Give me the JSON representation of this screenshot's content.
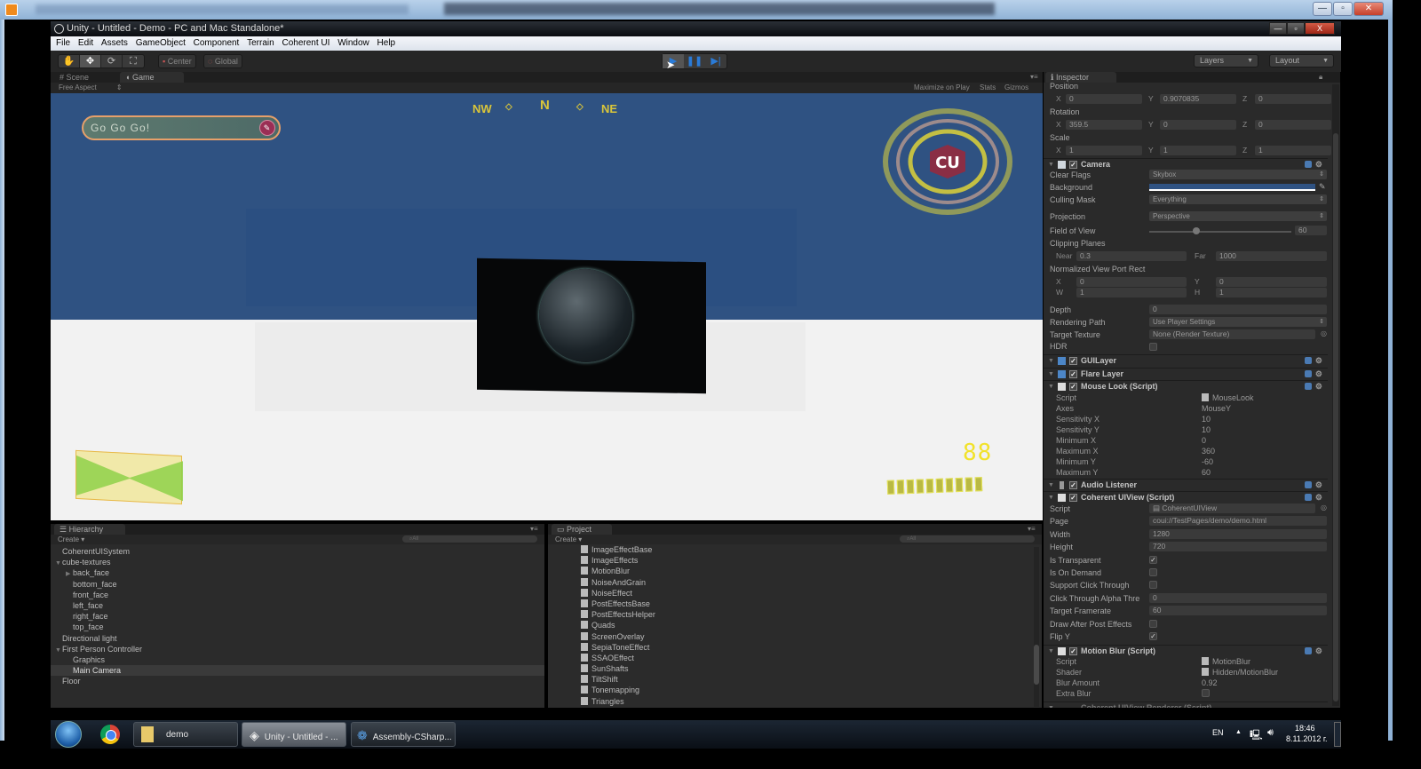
{
  "window": {
    "title": "Unity - Untitled - Demo - PC and Mac Standalone*",
    "controls": {
      "minimize": "—",
      "maximize": "▫",
      "close": "X"
    }
  },
  "menu": [
    "File",
    "Edit",
    "Assets",
    "GameObject",
    "Component",
    "Terrain",
    "Coherent UI",
    "Window",
    "Help"
  ],
  "toolbar": {
    "tools": [
      "hand-icon",
      "move-icon",
      "rotate-icon",
      "scale-icon"
    ],
    "pivot_center": "Center",
    "pivot_global": "Global",
    "play": "▶",
    "pause": "❚❚",
    "step": "▶|",
    "layers": "Layers",
    "layout": "Layout"
  },
  "tabs": {
    "scene": "Scene",
    "game": "Game",
    "inspector": "Inspector",
    "hierarchy": "Hierarchy",
    "project": "Project"
  },
  "game_view": {
    "aspect": "Free Aspect",
    "maximize_on_play": "Maximize on Play",
    "stats": "Stats",
    "gizmos": "Gizmos",
    "hud": {
      "chat_text": "Go Go Go!",
      "compass": {
        "nw": "NW",
        "n": "N",
        "ne": "NE"
      },
      "logo": "CU",
      "health": "88",
      "health_segments": 10,
      "health_fraction": 1.0
    }
  },
  "hierarchy": {
    "create": "Create ▾",
    "search_placeholder": "All",
    "items": [
      {
        "label": "CoherentUISystem",
        "depth": 0,
        "arrow": ""
      },
      {
        "label": "cube-textures",
        "depth": 0,
        "arrow": "▼"
      },
      {
        "label": "back_face",
        "depth": 1,
        "arrow": "▶"
      },
      {
        "label": "bottom_face",
        "depth": 1,
        "arrow": ""
      },
      {
        "label": "front_face",
        "depth": 1,
        "arrow": ""
      },
      {
        "label": "left_face",
        "depth": 1,
        "arrow": ""
      },
      {
        "label": "right_face",
        "depth": 1,
        "arrow": ""
      },
      {
        "label": "top_face",
        "depth": 1,
        "arrow": ""
      },
      {
        "label": "Directional light",
        "depth": 0,
        "arrow": ""
      },
      {
        "label": "First Person Controller",
        "depth": 0,
        "arrow": "▼"
      },
      {
        "label": "Graphics",
        "depth": 1,
        "arrow": ""
      },
      {
        "label": "Main Camera",
        "depth": 1,
        "arrow": "",
        "selected": true
      },
      {
        "label": "Floor",
        "depth": 0,
        "arrow": ""
      }
    ]
  },
  "project": {
    "create": "Create ▾",
    "search_placeholder": "All",
    "items": [
      "ImageEffectBase",
      "ImageEffects",
      "MotionBlur",
      "NoiseAndGrain",
      "NoiseEffect",
      "PostEffectsBase",
      "PostEffectsHelper",
      "Quads",
      "ScreenOverlay",
      "SepiaToneEffect",
      "SSAOEffect",
      "SunShafts",
      "TiltShift",
      "Tonemapping",
      "Triangles"
    ]
  },
  "inspector": {
    "transform": {
      "position_label": "Position",
      "position": {
        "x": "0",
        "y": "0.9070835",
        "z": "0"
      },
      "rotation_label": "Rotation",
      "rotation": {
        "x": "359.5",
        "y": "0",
        "z": "0"
      },
      "scale_label": "Scale",
      "scale": {
        "x": "1",
        "y": "1",
        "z": "1"
      }
    },
    "camera": {
      "title": "Camera",
      "clear_flags_label": "Clear Flags",
      "clear_flags": "Skybox",
      "background_label": "Background",
      "background_color": "#2f5282",
      "culling_mask_label": "Culling Mask",
      "culling_mask": "Everything",
      "projection_label": "Projection",
      "projection": "Perspective",
      "fov_label": "Field of View",
      "fov": "60",
      "fov_slider_fraction": 0.33,
      "clipping_label": "Clipping Planes",
      "near_label": "Near",
      "near": "0.3",
      "far_label": "Far",
      "far": "1000",
      "viewport_label": "Normalized View Port Rect",
      "vp_x": "0",
      "vp_y": "0",
      "vp_w": "1",
      "vp_h": "1",
      "depth_label": "Depth",
      "depth": "0",
      "rendering_path_label": "Rendering Path",
      "rendering_path": "Use Player Settings",
      "target_texture_label": "Target Texture",
      "target_texture": "None (Render Texture)",
      "hdr_label": "HDR",
      "hdr": false
    },
    "gui_layer": "GUILayer",
    "flare_layer": "Flare Layer",
    "mouse_look": {
      "title": "Mouse Look (Script)",
      "fields": [
        {
          "label": "Script",
          "value": "MouseLook"
        },
        {
          "label": "Axes",
          "value": "MouseY"
        },
        {
          "label": "Sensitivity X",
          "value": "10"
        },
        {
          "label": "Sensitivity Y",
          "value": "10"
        },
        {
          "label": "Minimum X",
          "value": "0"
        },
        {
          "label": "Maximum X",
          "value": "360"
        },
        {
          "label": "Minimum Y",
          "value": "-60"
        },
        {
          "label": "Maximum Y",
          "value": "60"
        }
      ]
    },
    "audio_listener": "Audio Listener",
    "coherent_view": {
      "title": "Coherent UIView (Script)",
      "script_label": "Script",
      "script": "CoherentUIView",
      "page_label": "Page",
      "page": "coui://TestPages/demo/demo.html",
      "width_label": "Width",
      "width": "1280",
      "height_label": "Height",
      "height": "720",
      "is_transparent_label": "Is Transparent",
      "is_transparent": true,
      "is_on_demand_label": "Is On Demand",
      "is_on_demand": false,
      "click_through_label": "Support Click Through",
      "click_through": false,
      "alpha_label": "Click Through Alpha Thre",
      "alpha": "0",
      "framerate_label": "Target Framerate",
      "framerate": "60",
      "draw_after_label": "Draw After Post Effects",
      "draw_after": false,
      "flip_y_label": "Flip Y",
      "flip_y": true
    },
    "motion_blur": {
      "title": "Motion Blur (Script)",
      "fields": [
        {
          "label": "Script",
          "value": "MotionBlur"
        },
        {
          "label": "Shader",
          "value": "Hidden/MotionBlur"
        },
        {
          "label": "Blur Amount",
          "value": "0.92"
        }
      ],
      "extra_blur_label": "Extra Blur",
      "extra_blur": false
    },
    "next_component": "Coherent UIView Renderer (Script)"
  },
  "taskbar": {
    "items": [
      {
        "label": "demo",
        "icon": "folder-icon"
      },
      {
        "label": "Unity - Untitled - ...",
        "icon": "unity-icon",
        "active": true
      },
      {
        "label": "Assembly-CSharp...",
        "icon": "monodevelop-icon"
      }
    ],
    "lang": "EN",
    "time": "18:46",
    "date": "8.11.2012 г."
  }
}
